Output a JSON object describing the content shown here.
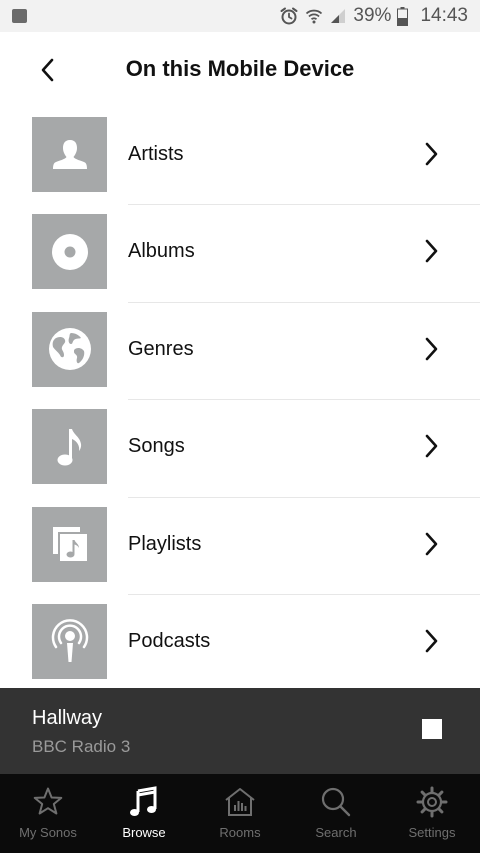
{
  "status_bar": {
    "battery_percent": "39%",
    "time": "14:43",
    "icons": [
      "sonos-app-icon",
      "alarm-icon",
      "wifi-icon",
      "signal-icon",
      "battery-icon"
    ]
  },
  "header": {
    "title": "On this Mobile Device",
    "back_icon": "chevron-left-icon"
  },
  "list": {
    "items": [
      {
        "label": "Artists",
        "icon": "person-icon"
      },
      {
        "label": "Albums",
        "icon": "disc-icon"
      },
      {
        "label": "Genres",
        "icon": "globe-icon"
      },
      {
        "label": "Songs",
        "icon": "music-note-icon"
      },
      {
        "label": "Playlists",
        "icon": "playlist-icon"
      },
      {
        "label": "Podcasts",
        "icon": "podcast-icon"
      }
    ],
    "chevron_icon": "chevron-right-icon"
  },
  "now_playing": {
    "room": "Hallway",
    "station": "BBC Radio 3",
    "control_icon": "stop-icon"
  },
  "tabs": [
    {
      "label": "My Sonos",
      "icon": "star-icon",
      "active": false
    },
    {
      "label": "Browse",
      "icon": "music-note-icon",
      "active": true
    },
    {
      "label": "Rooms",
      "icon": "rooms-icon",
      "active": false
    },
    {
      "label": "Search",
      "icon": "search-icon",
      "active": false
    },
    {
      "label": "Settings",
      "icon": "gear-icon",
      "active": false
    }
  ],
  "colors": {
    "thumb_bg": "#a6a8a9",
    "now_playing_bg": "#333333",
    "tabbar_bg": "#0b0b0b",
    "tab_inactive": "#6f6f6f",
    "tab_active": "#ffffff"
  }
}
